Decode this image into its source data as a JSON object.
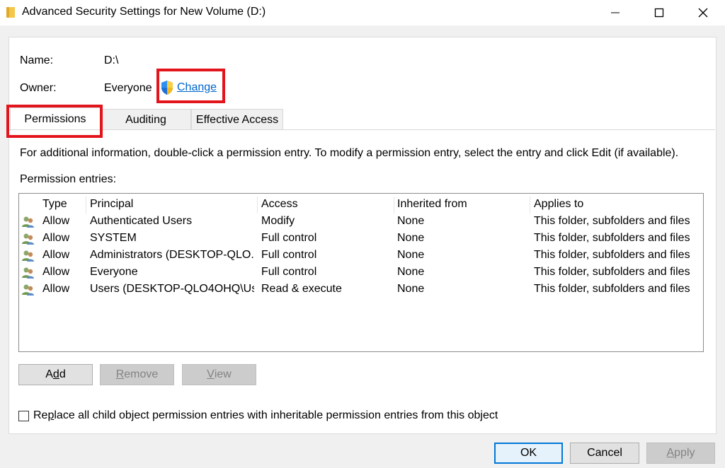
{
  "window": {
    "title": "Advanced Security Settings for New Volume (D:)"
  },
  "info": {
    "name_label": "Name:",
    "name_value": "D:\\",
    "owner_label": "Owner:",
    "owner_value": "Everyone",
    "change_link": "Change"
  },
  "tabs": [
    {
      "label": "Permissions",
      "active": true
    },
    {
      "label": "Auditing",
      "active": false
    },
    {
      "label": "Effective Access",
      "active": false
    }
  ],
  "instructions": "For additional information, double-click a permission entry. To modify a permission entry, select the entry and click Edit (if available).",
  "entries_label": "Permission entries:",
  "table": {
    "headers": [
      "Type",
      "Principal",
      "Access",
      "Inherited from",
      "Applies to"
    ],
    "rows": [
      {
        "type": "Allow",
        "principal": "Authenticated Users",
        "access": "Modify",
        "inherited": "None",
        "applies": "This folder, subfolders and files"
      },
      {
        "type": "Allow",
        "principal": "SYSTEM",
        "access": "Full control",
        "inherited": "None",
        "applies": "This folder, subfolders and files"
      },
      {
        "type": "Allow",
        "principal": "Administrators (DESKTOP-QLO...",
        "access": "Full control",
        "inherited": "None",
        "applies": "This folder, subfolders and files"
      },
      {
        "type": "Allow",
        "principal": "Everyone",
        "access": "Full control",
        "inherited": "None",
        "applies": "This folder, subfolders and files"
      },
      {
        "type": "Allow",
        "principal": "Users (DESKTOP-QLO4OHQ\\Us...",
        "access": "Read & execute",
        "inherited": "None",
        "applies": "This folder, subfolders and files"
      }
    ]
  },
  "list_buttons": {
    "add": {
      "pre": "A",
      "ul": "d",
      "post": "d"
    },
    "remove": {
      "pre": "",
      "ul": "R",
      "post": "emove"
    },
    "view": {
      "pre": "",
      "ul": "V",
      "post": "iew"
    }
  },
  "replace_checkbox": {
    "pre": "Re",
    "ul": "p",
    "post": "lace all child object permission entries with inheritable permission entries from this object",
    "checked": false
  },
  "footer": {
    "ok": "OK",
    "cancel": "Cancel",
    "apply_pre": "",
    "apply_ul": "A",
    "apply_post": "pply"
  },
  "colors": {
    "highlight": "#e3151c",
    "link": "#0066cc",
    "default_button_border": "#0078d7"
  }
}
